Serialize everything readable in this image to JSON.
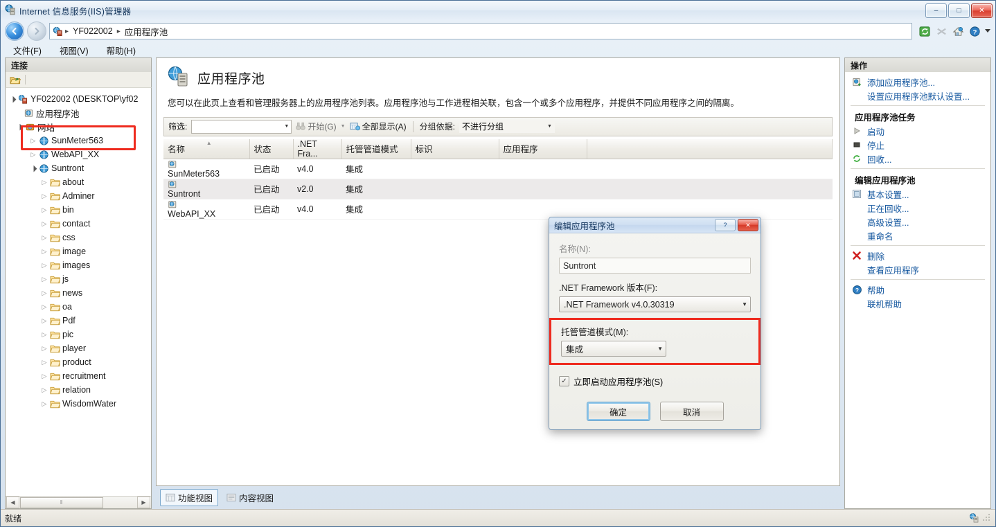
{
  "window": {
    "title": "Internet 信息服务(IIS)管理器",
    "minimize_label": "–",
    "maximize_label": "□",
    "close_label": "✕"
  },
  "address": {
    "back_label": "◀",
    "forward_label": "▶",
    "crumbs": [
      "YF022002",
      "应用程序池"
    ],
    "separator": "▸",
    "icons": [
      "refresh-icon",
      "disconnect-icon",
      "home-icon",
      "help-icon",
      "help-dropdown-arrow"
    ]
  },
  "menu": {
    "items": [
      "文件(F)",
      "视图(V)",
      "帮助(H)"
    ]
  },
  "connections": {
    "header": "连接",
    "tree": [
      {
        "label": "YF022002 (\\DESKTOP\\yf02",
        "icon": "server-icon",
        "indent": 0,
        "expander": "open"
      },
      {
        "label": "应用程序池",
        "icon": "app-pool-icon",
        "indent": 1,
        "expander": "none",
        "highlighted": true
      },
      {
        "label": "网站",
        "icon": "sites-icon",
        "indent": 1,
        "expander": "open"
      },
      {
        "label": "SunMeter563",
        "icon": "site-icon",
        "indent": 2,
        "expander": "closed"
      },
      {
        "label": "WebAPI_XX",
        "icon": "site-icon",
        "indent": 2,
        "expander": "closed"
      },
      {
        "label": "Suntront",
        "icon": "site-icon",
        "indent": 2,
        "expander": "open"
      },
      {
        "label": "about",
        "icon": "folder-icon",
        "indent": 3,
        "expander": "closed"
      },
      {
        "label": "Adminer",
        "icon": "folder-icon",
        "indent": 3,
        "expander": "closed"
      },
      {
        "label": "bin",
        "icon": "folder-icon",
        "indent": 3,
        "expander": "closed"
      },
      {
        "label": "contact",
        "icon": "folder-icon",
        "indent": 3,
        "expander": "closed"
      },
      {
        "label": "css",
        "icon": "folder-icon",
        "indent": 3,
        "expander": "closed"
      },
      {
        "label": "image",
        "icon": "folder-icon",
        "indent": 3,
        "expander": "closed"
      },
      {
        "label": "images",
        "icon": "folder-icon",
        "indent": 3,
        "expander": "closed"
      },
      {
        "label": "js",
        "icon": "folder-icon",
        "indent": 3,
        "expander": "closed"
      },
      {
        "label": "news",
        "icon": "folder-icon",
        "indent": 3,
        "expander": "closed"
      },
      {
        "label": "oa",
        "icon": "folder-icon",
        "indent": 3,
        "expander": "closed"
      },
      {
        "label": "Pdf",
        "icon": "folder-icon",
        "indent": 3,
        "expander": "closed"
      },
      {
        "label": "pic",
        "icon": "folder-icon",
        "indent": 3,
        "expander": "closed"
      },
      {
        "label": "player",
        "icon": "folder-icon",
        "indent": 3,
        "expander": "closed"
      },
      {
        "label": "product",
        "icon": "folder-icon",
        "indent": 3,
        "expander": "closed"
      },
      {
        "label": "recruitment",
        "icon": "folder-icon",
        "indent": 3,
        "expander": "closed"
      },
      {
        "label": "relation",
        "icon": "folder-icon",
        "indent": 3,
        "expander": "closed"
      },
      {
        "label": "WisdomWater",
        "icon": "folder-icon",
        "indent": 3,
        "expander": "closed"
      }
    ],
    "scroll_thumb_glyph": "‖"
  },
  "main": {
    "title": "应用程序池",
    "description": "您可以在此页上查看和管理服务器上的应用程序池列表。应用程序池与工作进程相关联，包含一个或多个应用程序，并提供不同应用程序之间的隔离。",
    "filter": {
      "label": "筛选:",
      "value": "",
      "go_label": "开始(G)",
      "show_all_label": "全部显示(A)",
      "group_by_label": "分组依据:",
      "group_by_value": "不进行分组"
    },
    "columns": [
      "名称",
      "状态",
      ".NET Fra...",
      "托管管道模式",
      "标识",
      "应用程序"
    ],
    "sort_column": "名称",
    "rows": [
      {
        "name": "SunMeter563",
        "status": "已启动",
        "framework": "v4.0",
        "pipeline": "集成",
        "identity": "",
        "applications": "",
        "selected": false
      },
      {
        "name": "Suntront",
        "status": "已启动",
        "framework": "v2.0",
        "pipeline": "集成",
        "identity": "",
        "applications": "",
        "selected": true
      },
      {
        "name": "WebAPI_XX",
        "status": "已启动",
        "framework": "v4.0",
        "pipeline": "集成",
        "identity": "",
        "applications": "",
        "selected": false
      }
    ],
    "view_tabs": [
      {
        "label": "功能视图",
        "active": true
      },
      {
        "label": "内容视图",
        "active": false
      }
    ]
  },
  "actions": {
    "header": "操作",
    "items": [
      {
        "label": "添加应用程序池...",
        "icon": "add-app-pool-icon",
        "type": "link"
      },
      {
        "label": "设置应用程序池默认设置...",
        "icon": "none",
        "type": "link"
      },
      {
        "label": "",
        "type": "separator"
      },
      {
        "label": "应用程序池任务",
        "type": "group"
      },
      {
        "label": "启动",
        "icon": "play-icon",
        "type": "link"
      },
      {
        "label": "停止",
        "icon": "stop-icon",
        "type": "link"
      },
      {
        "label": "回收...",
        "icon": "recycle-icon",
        "type": "link"
      },
      {
        "label": "",
        "type": "separator"
      },
      {
        "label": "编辑应用程序池",
        "type": "group"
      },
      {
        "label": "基本设置...",
        "icon": "basic-settings-icon",
        "type": "link"
      },
      {
        "label": "正在回收...",
        "icon": "none",
        "type": "link"
      },
      {
        "label": "高级设置...",
        "icon": "none",
        "type": "link"
      },
      {
        "label": "重命名",
        "icon": "none",
        "type": "link"
      },
      {
        "label": "",
        "type": "separator"
      },
      {
        "label": "删除",
        "icon": "delete-icon",
        "type": "link"
      },
      {
        "label": "查看应用程序",
        "icon": "none",
        "type": "link"
      },
      {
        "label": "",
        "type": "separator"
      },
      {
        "label": "帮助",
        "icon": "help-icon",
        "type": "link"
      },
      {
        "label": "联机帮助",
        "icon": "none",
        "type": "link"
      }
    ]
  },
  "dialog": {
    "title": "编辑应用程序池",
    "help_label": "?",
    "close_label": "✕",
    "name_label": "名称(N):",
    "name_value": "Suntront",
    "framework_label": ".NET Framework 版本(F):",
    "framework_value": ".NET Framework v4.0.30319",
    "pipeline_label": "托管管道模式(M):",
    "pipeline_value": "集成",
    "start_checkbox_label": "立即启动应用程序池(S)",
    "start_checkbox_checked": true,
    "ok_label": "确定",
    "cancel_label": "取消"
  },
  "status": {
    "text": "就绪"
  },
  "colors": {
    "highlight_red": "#ee2b1f",
    "link_blue": "#13569e",
    "selection_gray": "#eceaea"
  }
}
